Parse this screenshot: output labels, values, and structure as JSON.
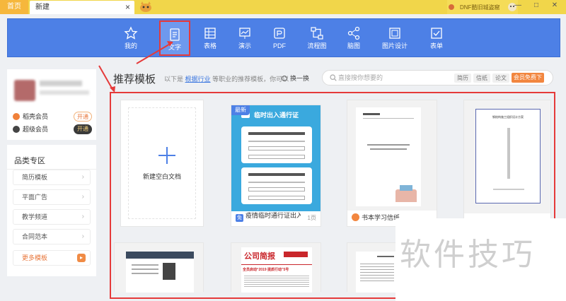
{
  "tabs": {
    "home": "首页",
    "new": "新建",
    "close": "×"
  },
  "promo": "DNF酷旧城盗窟",
  "window": {
    "minimize": "—",
    "restore": "□",
    "close": "✕"
  },
  "toolbar": {
    "items": [
      {
        "label": "我的",
        "icon": "star-icon"
      },
      {
        "label": "文字",
        "icon": "document-icon"
      },
      {
        "label": "表格",
        "icon": "table-icon"
      },
      {
        "label": "演示",
        "icon": "presentation-icon"
      },
      {
        "label": "PDF",
        "icon": "pdf-icon"
      },
      {
        "label": "流程图",
        "icon": "flowchart-icon"
      },
      {
        "label": "脑图",
        "icon": "mindmap-icon"
      },
      {
        "label": "图片设计",
        "icon": "image-design-icon"
      },
      {
        "label": "表单",
        "icon": "form-icon"
      }
    ],
    "active_index": 1
  },
  "members": [
    {
      "label": "稻壳会员",
      "button": "开通"
    },
    {
      "label": "超级会员",
      "button": "开通"
    }
  ],
  "category": {
    "title": "品类专区",
    "items": [
      "简历模板",
      "平面广告",
      "教学频道",
      "合同范本",
      "更多模板"
    ],
    "arrow": "›"
  },
  "section": {
    "title": "推荐模板",
    "desc_prefix": "以下是",
    "desc_link": "根据行业",
    "desc_suffix": "等职业的推荐模板，你可以",
    "refresh": "换一换"
  },
  "search": {
    "placeholder": "直接搜你想要的",
    "chips": [
      "简历",
      "信纸",
      "论文"
    ],
    "vip": "会员免费下"
  },
  "cards": {
    "blank_label": "新建空白文档",
    "new_badge": "最新",
    "c2_title": "临时出入通行证",
    "c2_caption": "疫情临时通行证出入证",
    "c2_icon": "免",
    "c2_pages": "1页",
    "c3_caption": "书本学习信纸",
    "c4_title": "钢结构施工组织设计方案",
    "row2_b_title": "公司简报",
    "row2_b_sub": "全员启动“2019 提质行动”5号"
  },
  "watermark": "软件技巧",
  "colors": {
    "accent": "#4d80e6",
    "highlight": "#e53a3a",
    "orange": "#f2863f"
  }
}
